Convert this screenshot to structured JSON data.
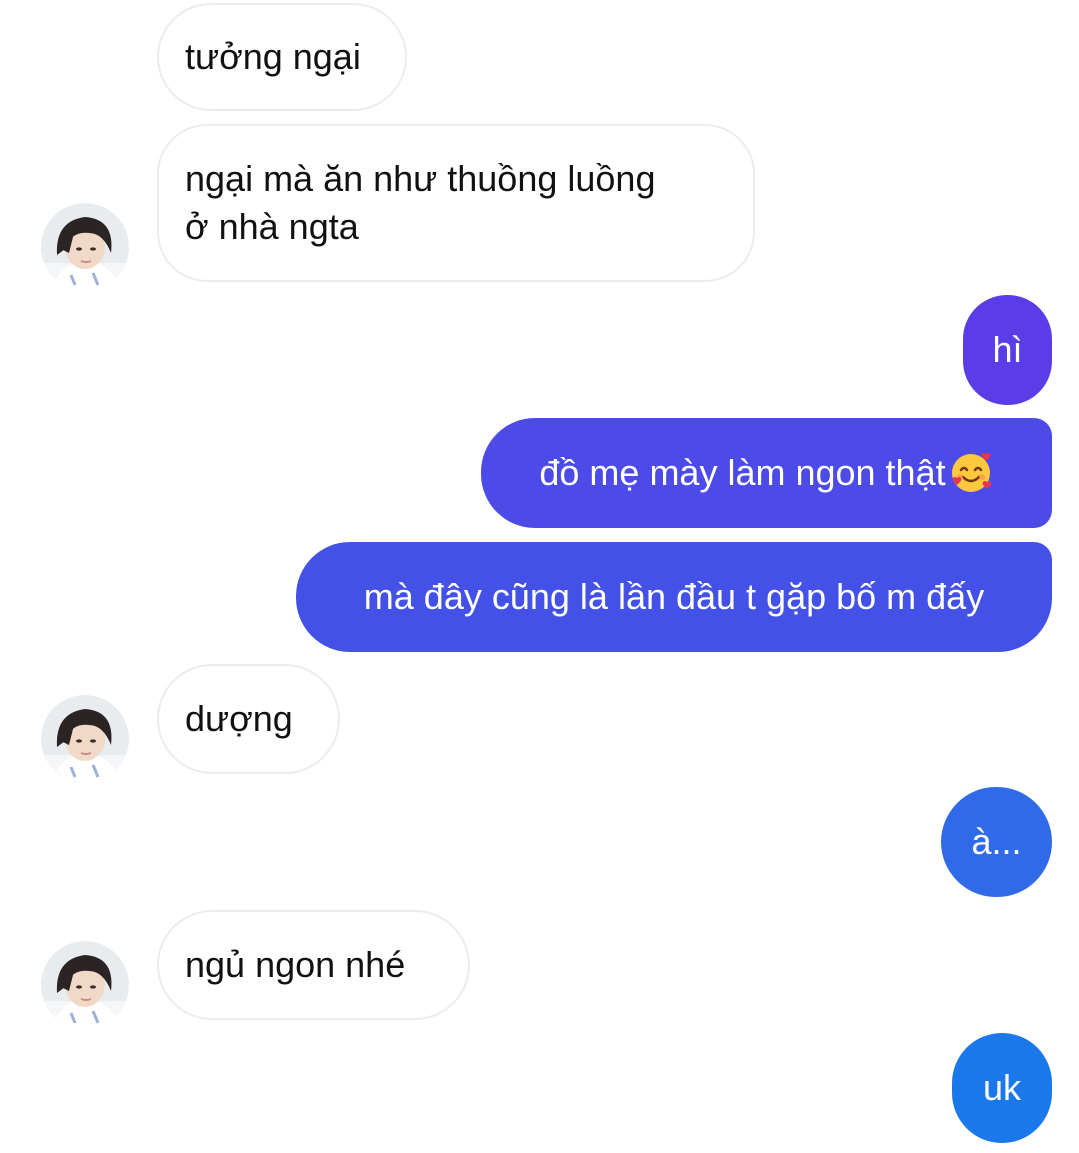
{
  "messages": [
    {
      "side": "received",
      "text": "tưởng ngại"
    },
    {
      "side": "received",
      "lines": [
        "ngại mà ăn như thuồng luồng",
        "ở nhà ngta"
      ]
    },
    {
      "side": "sent",
      "text": "hì"
    },
    {
      "side": "sent",
      "text": "đồ mẹ mày làm ngon thật",
      "emoji": "smiling-face-with-hearts"
    },
    {
      "side": "sent",
      "text": "mà đây cũng là lần đầu t gặp bố m đấy"
    },
    {
      "side": "received",
      "text": "dượng"
    },
    {
      "side": "sent",
      "text": "à..."
    },
    {
      "side": "received",
      "text": "ngủ ngon nhé"
    },
    {
      "side": "sent",
      "text": "uk"
    }
  ],
  "contact_avatar": "contact-avatar-photo",
  "colors": {
    "sent_gradient": [
      "#5b3de8",
      "#4b50e6",
      "#2f6ae9",
      "#1b78ea"
    ],
    "received_bubble": "#ffffff",
    "received_border": "#ececec"
  }
}
